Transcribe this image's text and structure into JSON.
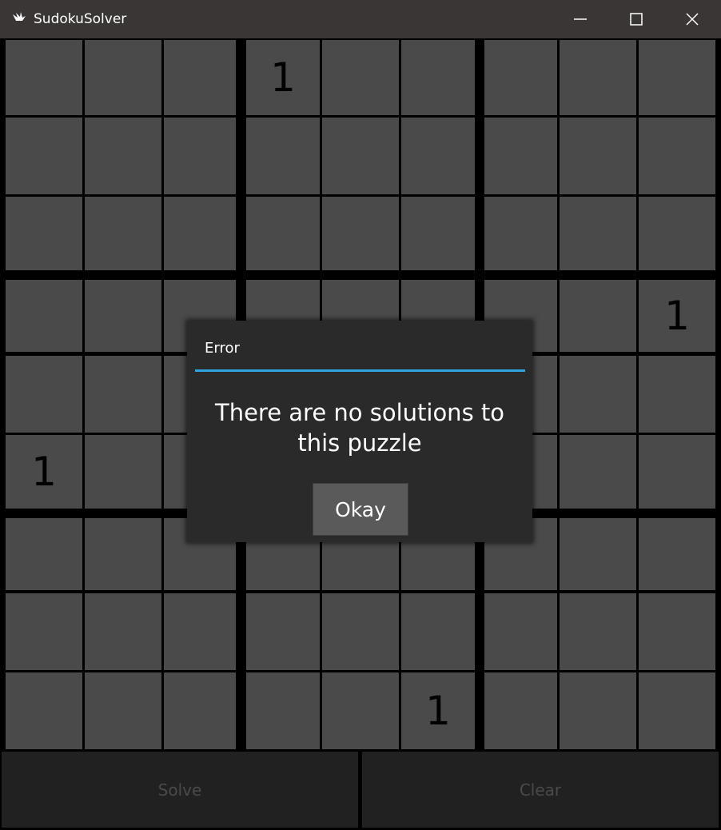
{
  "window": {
    "title": "SudokuSolver",
    "icon": "kivy-app-icon",
    "controls": [
      "minimize-icon",
      "maximize-icon",
      "close-icon"
    ]
  },
  "board": {
    "rows": [
      [
        "",
        "",
        "",
        "1",
        "",
        "",
        "",
        "",
        ""
      ],
      [
        "",
        "",
        "",
        "",
        "",
        "",
        "",
        "",
        ""
      ],
      [
        "",
        "",
        "",
        "",
        "",
        "",
        "",
        "",
        ""
      ],
      [
        "",
        "",
        "",
        "",
        "",
        "",
        "",
        "",
        "1"
      ],
      [
        "",
        "",
        "",
        "",
        "",
        "",
        "",
        "",
        ""
      ],
      [
        "1",
        "",
        "",
        "",
        "",
        "",
        "",
        "",
        ""
      ],
      [
        "",
        "",
        "",
        "",
        "",
        "",
        "",
        "",
        ""
      ],
      [
        "",
        "",
        "",
        "",
        "",
        "",
        "",
        "",
        ""
      ],
      [
        "",
        "",
        "",
        "",
        "",
        "1",
        "",
        "",
        ""
      ]
    ]
  },
  "actions": {
    "solve_label": "Solve",
    "clear_label": "Clear"
  },
  "dialog": {
    "title": "Error",
    "message": "There are no solutions to this puzzle",
    "button_label": "Okay"
  },
  "colors": {
    "titlebar": "#3a3636",
    "cell": "#4a4a4a",
    "grid_lines": "#000000",
    "button_bg": "#212121",
    "button_text": "#4a4a4a",
    "dialog_bg": "#2a2a2a",
    "dialog_accent": "#2fa3dd",
    "dialog_button": "#5a5a5a"
  }
}
